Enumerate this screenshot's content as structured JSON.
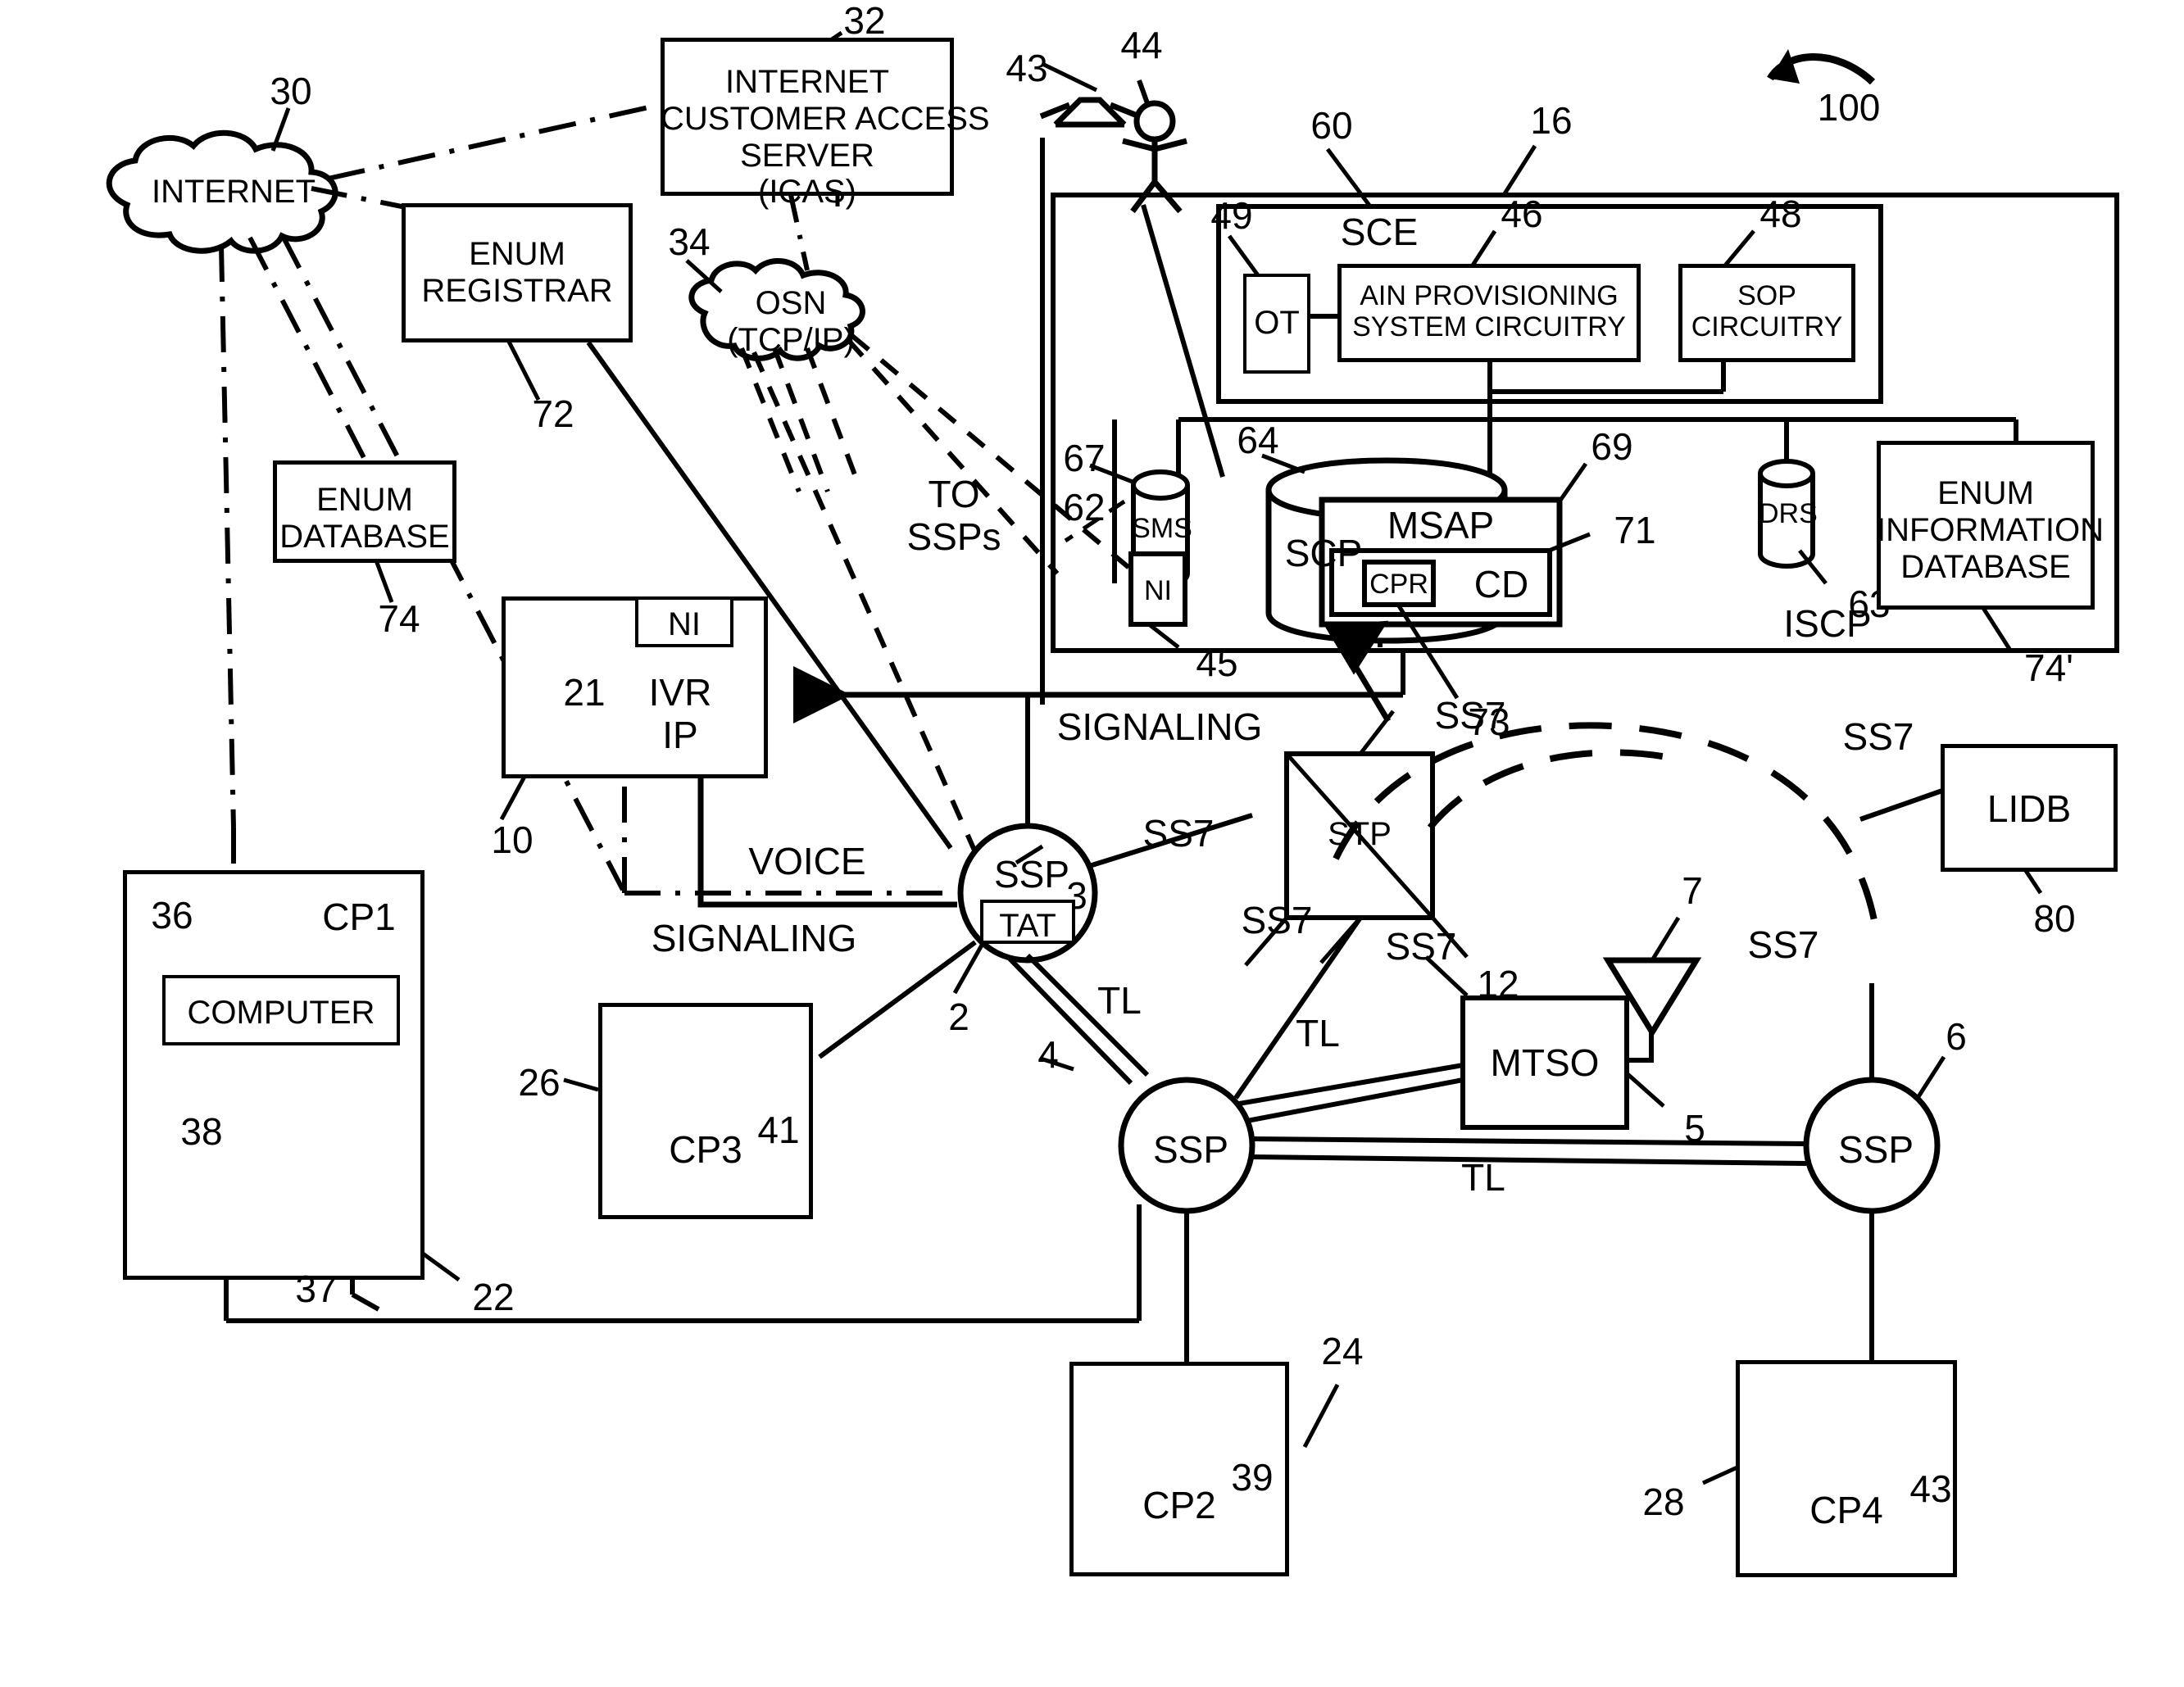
{
  "figure": {
    "overall_ref": "100",
    "domain": "telecommunications network architecture patent diagram"
  },
  "clouds": [
    {
      "name": "internet-cloud",
      "label": "INTERNET",
      "ref": "30"
    },
    {
      "name": "osn-cloud",
      "label": "OSN\n(TCP/IP)",
      "ref": "34"
    }
  ],
  "boxes": [
    {
      "name": "icas-box",
      "label": "INTERNET\nCUSTOMER ACCESS\nSERVER\n(ICAS)",
      "ref": "32"
    },
    {
      "name": "enum-registrar-box",
      "label": "ENUM\nREGISTRAR",
      "ref": "72"
    },
    {
      "name": "enum-database-box",
      "label": "ENUM\nDATABASE",
      "ref": "74"
    },
    {
      "name": "ivr-ip-box",
      "label": "IVR\nIP",
      "ref": "10"
    },
    {
      "name": "ni-ivr-box",
      "label": "NI",
      "ref": "21"
    },
    {
      "name": "ot-box",
      "label": "OT",
      "ref": "49"
    },
    {
      "name": "ain-provisioning-box",
      "label": "AIN PROVISIONING\nSYSTEM CIRCUITRY",
      "ref": "46"
    },
    {
      "name": "sop-circuitry-box",
      "label": "SOP\nCIRCUITRY",
      "ref": "48"
    },
    {
      "name": "sce-box",
      "label": "SCE",
      "ref": "60"
    },
    {
      "name": "iscp-box",
      "label": "ISCP",
      "ref": "16"
    },
    {
      "name": "ni-iscp-box",
      "label": "NI",
      "ref": "45"
    },
    {
      "name": "msap-box",
      "label": "MSAP",
      "ref": "69"
    },
    {
      "name": "cd-box",
      "label": "CD",
      "ref": "71"
    },
    {
      "name": "cpr-box",
      "label": "CPR",
      "ref": "73"
    },
    {
      "name": "enum-information-database-box",
      "label": "ENUM\nINFORMATION\nDATABASE",
      "ref": "74'"
    },
    {
      "name": "stp-box",
      "label": "STP",
      "ref": "12"
    },
    {
      "name": "lidb-box",
      "label": "LIDB",
      "ref": "80"
    },
    {
      "name": "mtso-box",
      "label": "MTSO",
      "ref": "5"
    },
    {
      "name": "cp1-box",
      "label": "CP1",
      "ref": "22"
    },
    {
      "name": "computer-box",
      "label": "COMPUTER",
      "ref": "36"
    },
    {
      "name": "cp2-box",
      "label": "CP2",
      "ref": "24"
    },
    {
      "name": "cp3-box",
      "label": "CP3",
      "ref": "26"
    },
    {
      "name": "cp4-box",
      "label": "CP4",
      "ref": "28"
    }
  ],
  "cylinders": [
    {
      "name": "sms-cylinder",
      "label": "SMS",
      "refs": [
        "67",
        "62"
      ]
    },
    {
      "name": "drs-cylinder",
      "label": "DRS",
      "ref": "63"
    }
  ],
  "scp": {
    "name": "scp-drum",
    "label": "SCP",
    "ref": "64"
  },
  "nodes": [
    {
      "name": "ssp-node-3",
      "label": "SSP",
      "ref": "3",
      "sub_label": "TAT",
      "sub_ref": "2"
    },
    {
      "name": "ssp-node-4",
      "label": "SSP",
      "ref": "4"
    },
    {
      "name": "ssp-node-6",
      "label": "SSP",
      "ref": "6"
    }
  ],
  "link_labels": [
    {
      "name": "link-label-signaling-upper",
      "text": "SIGNALING"
    },
    {
      "name": "link-label-signaling-lower",
      "text": "SIGNALING"
    },
    {
      "name": "link-label-voice",
      "text": "VOICE"
    },
    {
      "name": "link-label-to-ssps",
      "text": "TO\nSSPs"
    },
    {
      "name": "link-label-ss7-1",
      "text": "SS7"
    },
    {
      "name": "link-label-ss7-2",
      "text": "SS7"
    },
    {
      "name": "link-label-ss7-3",
      "text": "SS7"
    },
    {
      "name": "link-label-ss7-4",
      "text": "SS7"
    },
    {
      "name": "link-label-ss7-5",
      "text": "SS7"
    },
    {
      "name": "link-label-ss7-6",
      "text": "SS7"
    },
    {
      "name": "link-label-tl-1",
      "text": "TL"
    },
    {
      "name": "link-label-tl-2",
      "text": "TL"
    },
    {
      "name": "link-label-tl-3",
      "text": "TL"
    }
  ],
  "phone_refs": [
    {
      "name": "phone-ref-38",
      "text": "38"
    },
    {
      "name": "antenna-ref-37",
      "text": "37"
    },
    {
      "name": "phone-ref-41",
      "text": "41"
    },
    {
      "name": "phone-ref-39",
      "text": "39"
    },
    {
      "name": "phone-ref-43-cp4",
      "text": "43"
    },
    {
      "name": "phone-ref-43-top",
      "text": "43"
    },
    {
      "name": "operator-ref-44",
      "text": "44"
    },
    {
      "name": "antenna-ref-7",
      "text": "7"
    }
  ],
  "all_refs": [
    "30",
    "32",
    "34",
    "36",
    "37",
    "38",
    "39",
    "41",
    "43",
    "44",
    "45",
    "46",
    "48",
    "49",
    "60",
    "62",
    "63",
    "64",
    "67",
    "69",
    "71",
    "72",
    "73",
    "74",
    "74'",
    "80",
    "2",
    "3",
    "4",
    "5",
    "6",
    "7",
    "10",
    "12",
    "16",
    "21",
    "22",
    "24",
    "26",
    "28",
    "100"
  ],
  "colors": {
    "line": "#000000",
    "background": "#ffffff"
  }
}
